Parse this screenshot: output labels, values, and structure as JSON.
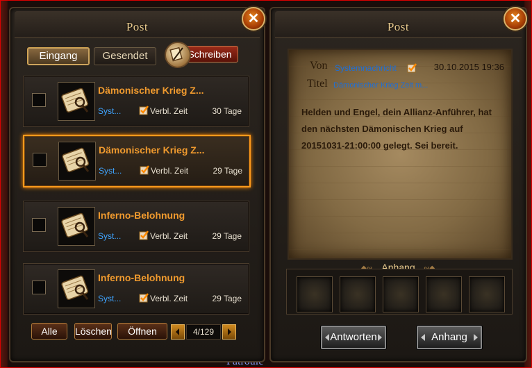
{
  "left_panel": {
    "title": "Post",
    "close_icon": "close-x",
    "tabs": [
      {
        "label": "Eingang",
        "active": true
      },
      {
        "label": "Gesendet",
        "active": false
      }
    ],
    "write_button": {
      "label": "Schreiben",
      "icon": "quill-scroll-icon"
    },
    "mails": [
      {
        "title": "Dämonischer Krieg Z...",
        "sender": "Syst...",
        "expires_label": "Verbl. Zeit",
        "days": "30 Tage",
        "selected": false
      },
      {
        "title": "Dämonischer Krieg Z...",
        "sender": "Syst...",
        "expires_label": "Verbl. Zeit",
        "days": "29 Tage",
        "selected": true
      },
      {
        "title": "Inferno-Belohnung",
        "sender": "Syst...",
        "expires_label": "Verbl. Zeit",
        "days": "29 Tage",
        "selected": false
      },
      {
        "title": "Inferno-Belohnung",
        "sender": "Syst...",
        "expires_label": "Verbl. Zeit",
        "days": "29 Tage",
        "selected": false
      }
    ],
    "buttons": {
      "all": "Alle",
      "delete": "Löschen",
      "open": "Öffnen"
    },
    "page": "4/129"
  },
  "right_panel": {
    "title": "Post",
    "from_label": "Von",
    "from_value": "Systemnachricht",
    "date": "30.10.2015 19:36",
    "title_label": "Titel",
    "title_value": "Dämonischer Krieg Zeit m...",
    "body": "Helden und Engel, dein Allianz-Anführer, hat den nächsten Dämonischen Krieg auf 20151031-21:00:00 gelegt. Sei bereit.",
    "attachment_title": "Anhang",
    "attachment_slots": 5,
    "reply_button": "Antworten",
    "attach_button": "Anhang"
  },
  "background_text": "Patrouie",
  "colors": {
    "accent_orange": "#f09a2e",
    "sender_blue": "#3fa4ff",
    "selected_border": "#ff9a1c"
  }
}
